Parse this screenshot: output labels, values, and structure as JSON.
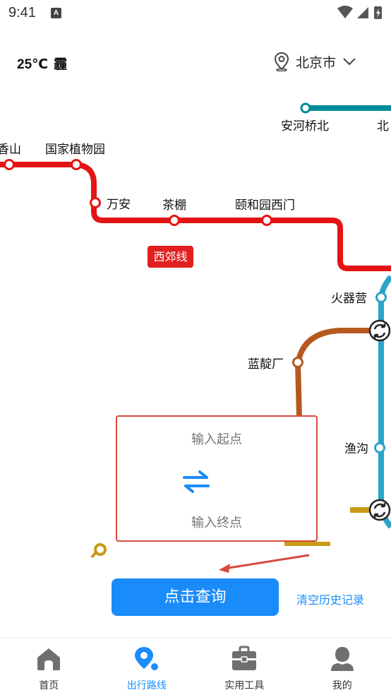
{
  "status_bar": {
    "time": "9:41",
    "notification_icon": "A"
  },
  "header": {
    "temperature": "25℃",
    "weather": "霾",
    "city": "北京市"
  },
  "map": {
    "stations": {
      "xiangshan": "香山",
      "botanical_garden": "国家植物园",
      "wanan": "万安",
      "chapeng": "茶棚",
      "summer_palace_west_gate": "颐和园西门",
      "anheqiao_north": "安河桥北",
      "bei_partial": "北",
      "huoqiying": "火器营",
      "landianchang": "蓝靛厂",
      "gou_partial": "渔沟"
    },
    "line_tag": "西郊线",
    "colors": {
      "xijiao_line": "#e51414",
      "line_10": "#2aa4c9",
      "line_4": "#008e9c",
      "line_6": "#b5591f",
      "line_gold": "#c99a15",
      "accent": "#1a8cfa",
      "card_border": "#d74b3d"
    }
  },
  "route": {
    "start_placeholder": "输入起点",
    "end_placeholder": "输入终点"
  },
  "actions": {
    "query_label": "点击查询",
    "clear_history_label": "清空历史记录"
  },
  "nav": {
    "items": [
      {
        "label": "首页",
        "icon": "home-icon"
      },
      {
        "label": "出行路线",
        "icon": "route-pin-icon"
      },
      {
        "label": "实用工具",
        "icon": "toolbox-icon"
      },
      {
        "label": "我的",
        "icon": "user-icon"
      }
    ],
    "active_index": 1
  }
}
